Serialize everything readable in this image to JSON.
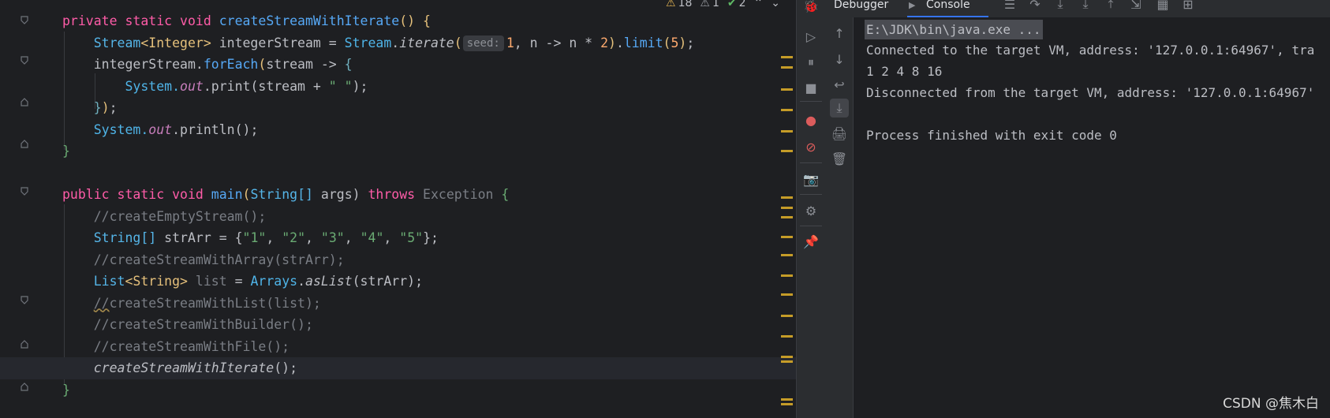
{
  "editor": {
    "inspections": {
      "warnings": "18",
      "weak_warnings": "1",
      "typos": "2"
    },
    "lines": [
      {
        "id": "l1"
      },
      {
        "id": "l2"
      }
    ],
    "code": {
      "l1_kw1": "private",
      "l1_kw2": "static",
      "l1_kw3": "void",
      "l1_fn": "createStreamWithIterate",
      "l1_rest": "() {",
      "l2_type1": "Stream",
      "l2_gen": "<Integer>",
      "l2_var": " integerStream = ",
      "l2_cls": "Stream",
      "l2_dot": ".",
      "l2_iter": "iterate",
      "l2_hint": "seed:",
      "l2_args": "1, n -> n * 2",
      "l2_close": ").",
      "l2_limit": "limit",
      "l2_lim": "(5);",
      "l3_a": "integerStream.",
      "l3_b": "forEach",
      "l3_c": "(stream -> {",
      "l4_a": "System.",
      "l4_b": "out",
      "l4_c": ".print(stream + ",
      "l4_d": "\" \"",
      "l4_e": ");",
      "l5": "});",
      "l6_a": "System.",
      "l6_b": "out",
      "l6_c": ".println();",
      "l7": "}",
      "l9_kw1": "public",
      "l9_kw2": "static",
      "l9_kw3": "void",
      "l9_fn": "main",
      "l9_b": "(",
      "l9_t": "String[]",
      "l9_c": " args) ",
      "l9_kw4": "throws",
      "l9_d": " Exception {",
      "l10": "//createEmptyStream();",
      "l11_t": "String[]",
      "l11_a": " strArr = {",
      "l11_s1": "\"1\"",
      "l11_s2": "\"2\"",
      "l11_s3": "\"3\"",
      "l11_s4": "\"4\"",
      "l11_s5": "\"5\"",
      "l11_end": "};",
      "l12": "//createStreamWithArray(strArr);",
      "l13_t": "List",
      "l13_g": "<String>",
      "l13_a": " list = ",
      "l13_c": "Arrays",
      "l13_d": ".",
      "l13_m": "asList",
      "l13_e": "(strArr);",
      "l14_a": "//",
      "l14_b": "createStreamWithList(list);",
      "l15": "//createStreamWithBuilder();",
      "l16": "//createStreamWithFile();",
      "l17_a": "createStreamWithIterate",
      "l17_b": "();",
      "l18": "}"
    }
  },
  "debugger": {
    "tabs": {
      "debugger": "Debugger",
      "console": "Console"
    },
    "console_lines": {
      "cmd": "E:\\JDK\\bin\\java.exe ...",
      "l2": "Connected to the target VM, address: '127.0.0.1:64967', tra",
      "l3": "1 2 4 8 16",
      "l4": "Disconnected from the target VM, address: '127.0.0.1:64967'",
      "l6": "Process finished with exit code 0"
    }
  },
  "watermark": "CSDN @焦木白",
  "colors": {
    "accent": "#3574f0",
    "warning_mark": "#c59c28"
  }
}
